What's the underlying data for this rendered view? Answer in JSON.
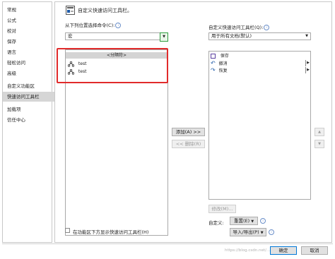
{
  "nav": {
    "items": [
      "常规",
      "公式",
      "校对",
      "保存",
      "语言",
      "轻松访问",
      "高级",
      "自定义功能区",
      "快速访问工具栏",
      "加载项",
      "信任中心"
    ],
    "active_index": 8
  },
  "header": {
    "title": "自定义快速访问工具栏。"
  },
  "left_panel": {
    "choose_label": "从下列位置选择命令(C):",
    "choose_value": "宏",
    "commands": [
      "<分隔符>",
      "test",
      "test"
    ]
  },
  "right_panel": {
    "customize_label": "自定义快速访问工具栏(Q):",
    "customize_value": "用于所有文档(默认)",
    "items": [
      "保存",
      "撤消",
      "恢复"
    ]
  },
  "buttons": {
    "add": "添加(A) >>",
    "remove": "<< 删除(R)",
    "modify": "修改(M)...",
    "customize_label": "自定义:",
    "reset": "重置(E)",
    "import_export": "导入/导出(P)",
    "ok": "确定",
    "cancel": "取消"
  },
  "checkbox": {
    "label": "在功能区下方显示快速访问工具栏(H)",
    "checked": false
  },
  "info_glyph": "i",
  "watermark": "https://blog.csdn.net/..."
}
